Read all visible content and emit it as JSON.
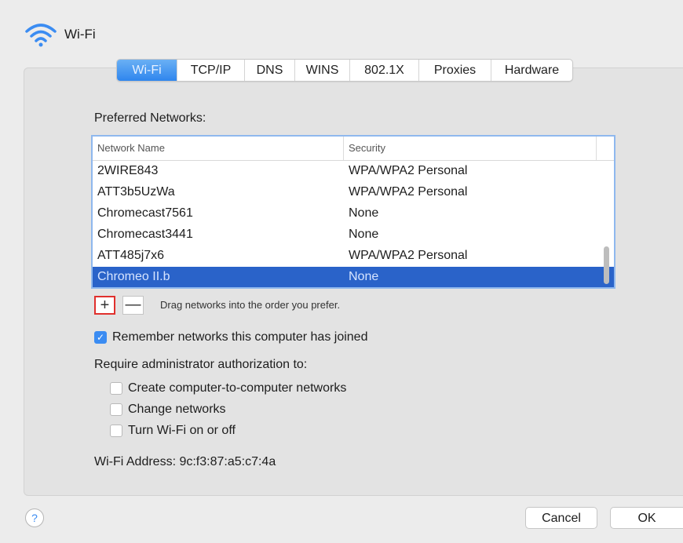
{
  "header": {
    "title": "Wi-Fi",
    "icon": "wifi-icon"
  },
  "tabs": [
    {
      "label": "Wi-Fi",
      "active": true
    },
    {
      "label": "TCP/IP"
    },
    {
      "label": "DNS"
    },
    {
      "label": "WINS"
    },
    {
      "label": "802.1X"
    },
    {
      "label": "Proxies"
    },
    {
      "label": "Hardware"
    }
  ],
  "preferred": {
    "label": "Preferred Networks:",
    "columns": [
      "Network Name",
      "Security"
    ],
    "rows": [
      {
        "name": "2WIRE843",
        "security": "WPA/WPA2 Personal"
      },
      {
        "name": "ATT3b5UzWa",
        "security": "WPA/WPA2 Personal"
      },
      {
        "name": "Chromecast7561",
        "security": "None"
      },
      {
        "name": "Chromecast3441",
        "security": "None"
      },
      {
        "name": "ATT485j7x6",
        "security": "WPA/WPA2 Personal"
      },
      {
        "name": "Chromeo II.b",
        "security": "None",
        "selected": true
      }
    ]
  },
  "list_controls": {
    "add": "+",
    "remove": "—",
    "hint": "Drag networks into the order you prefer."
  },
  "remember": {
    "label": "Remember networks this computer has joined",
    "checked": true
  },
  "require": {
    "label": "Require administrator authorization to:",
    "options": [
      {
        "label": "Create computer-to-computer networks",
        "checked": false
      },
      {
        "label": "Change networks",
        "checked": false
      },
      {
        "label": "Turn Wi-Fi on or off",
        "checked": false
      }
    ]
  },
  "address": "Wi-Fi Address:  9c:f3:87:a5:c7:4a",
  "footer": {
    "help": "?",
    "cancel": "Cancel",
    "ok": "OK"
  },
  "colors": {
    "accent": "#2f86ee",
    "selection": "#2a63c9",
    "highlight_border": "#e0302d"
  }
}
